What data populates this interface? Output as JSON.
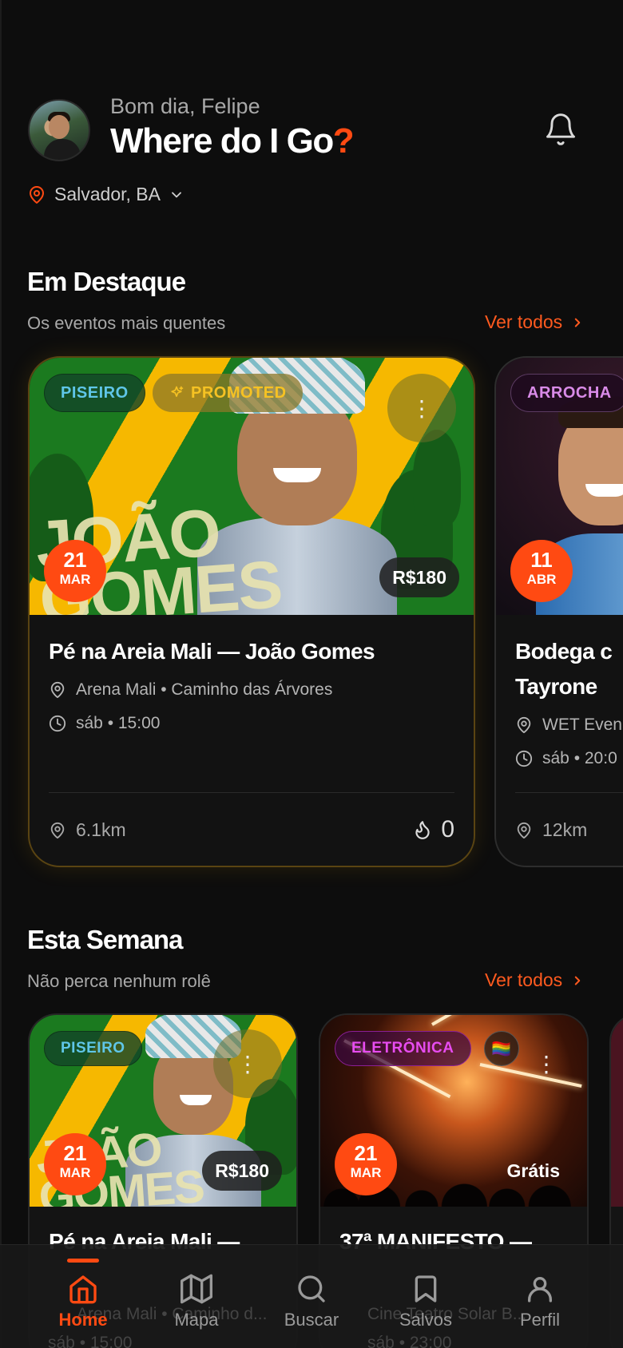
{
  "header": {
    "greeting": "Bom dia, Felipe",
    "title": "Where do I Go",
    "title_mark": "?",
    "location": "Salvador, BA"
  },
  "featured": {
    "title": "Em Destaque",
    "subtitle": "Os eventos mais quentes",
    "see_all": "Ver todos",
    "cards": [
      {
        "genre": "PISEIRO",
        "promoted": "PROMOTED",
        "day": "21",
        "month": "MAR",
        "price": "R$180",
        "poster_text": "JOÃO GOMES",
        "title": "Pé na Areia Mali — João Gomes",
        "venue": "Arena Mali • Caminho das Árvores",
        "time": "sáb • 15:00",
        "distance": "6.1km",
        "hot_count": "0"
      },
      {
        "genre": "ARROCHA",
        "day": "11",
        "month": "ABR",
        "title_line1": "Bodega c",
        "title_line2": "Tayrone",
        "venue": "WET Even",
        "time": "sáb • 20:0",
        "distance": "12km"
      }
    ]
  },
  "week": {
    "title": "Esta Semana",
    "subtitle": "Não perca nenhum rolê",
    "see_all": "Ver todos",
    "cards": [
      {
        "genre": "PISEIRO",
        "day": "21",
        "month": "MAR",
        "price": "R$180",
        "poster_text": "JOÃO GOMES",
        "title": "Pé na Areia Mali —",
        "venue_partial": "Arena Mali • Caminho d...",
        "time_partial": "sáb • 15:00"
      },
      {
        "genre": "ELETRÔNICA",
        "flag": "🏳️‍🌈",
        "day": "21",
        "month": "MAR",
        "price": "Grátis",
        "title": "37ª MANIFESTO —",
        "venue_partial": "Cine Teatro Solar B...",
        "time_partial": "sáb • 23:00"
      }
    ]
  },
  "nav": {
    "items": [
      {
        "label": "Home",
        "icon": "home-icon",
        "active": true
      },
      {
        "label": "Mapa",
        "icon": "map-icon"
      },
      {
        "label": "Buscar",
        "icon": "search-icon"
      },
      {
        "label": "Salvos",
        "icon": "bookmark-icon"
      },
      {
        "label": "Perfil",
        "icon": "user-icon"
      }
    ]
  },
  "colors": {
    "accent": "#ff4a12",
    "background": "#0d0d0d",
    "genre_piseiro": "#5fc6e8",
    "promoted": "#f6c223",
    "genre_arrocha": "#d98be8",
    "genre_eletronica": "#e74cf0"
  }
}
